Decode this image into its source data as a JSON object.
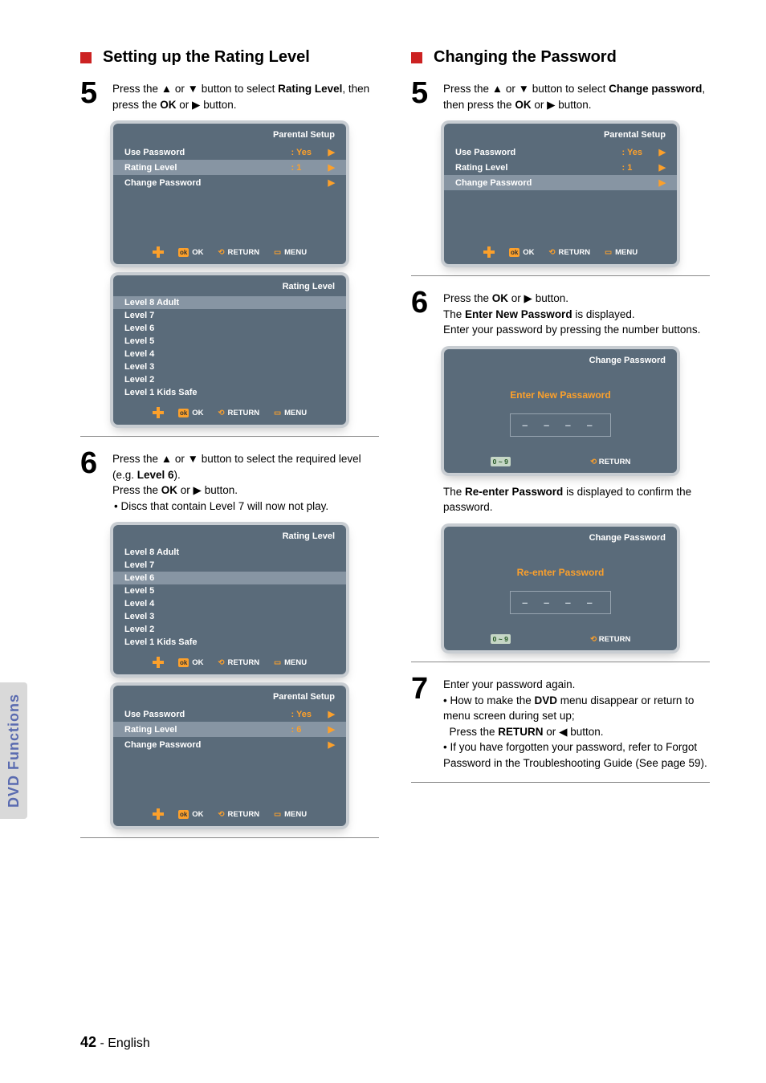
{
  "sideTab": "DVD Functions",
  "left": {
    "sectionTitle": "Setting up the Rating  Level",
    "step5": {
      "num": "5",
      "pre": "Press the ",
      "glyph1": "▲",
      "mid1": " or ",
      "glyph2": "▼",
      "mid2": " button to select ",
      "bold1": "Rating Level",
      "mid3": ", then press the ",
      "bold2": "OK",
      "mid4": " or ",
      "glyph3": "▶",
      "end": " button."
    },
    "panel1": {
      "title": "Parental Setup",
      "rows": [
        {
          "label": "Use Password",
          "value": ": Yes",
          "arrow": "▶"
        },
        {
          "label": "Rating Level",
          "value": ": 1",
          "arrow": "▶",
          "hl": true
        },
        {
          "label": "Change Password",
          "value": "",
          "arrow": "▶"
        }
      ]
    },
    "panel2": {
      "title": "Rating Level",
      "items": [
        "Level 8 Adult",
        "Level 7",
        "Level 6",
        "Level 5",
        "Level 4",
        "Level 3",
        "Level 2",
        "Level 1 Kids Safe"
      ],
      "hlIndex": 0
    },
    "step6": {
      "num": "6",
      "pre": "Press the ",
      "glyph1": "▲",
      "mid1": " or ",
      "glyph2": "▼",
      "mid2": " button to select the required level (e.g. ",
      "bold1": "Level 6",
      "mid3": ").",
      "line2a": "Press the ",
      "line2b": "OK",
      "line2c": " or ",
      "line2g": "▶",
      "line2d": " button.",
      "bullet": "• Discs that contain Level 7 will now not play."
    },
    "panel3": {
      "title": "Rating Level",
      "items": [
        "Level 8 Adult",
        "Level 7",
        "Level 6",
        "Level 5",
        "Level 4",
        "Level 3",
        "Level 2",
        "Level 1 Kids Safe"
      ],
      "hlIndex": 2
    },
    "panel4": {
      "title": "Parental Setup",
      "rows": [
        {
          "label": "Use Password",
          "value": ": Yes",
          "arrow": "▶"
        },
        {
          "label": "Rating Level",
          "value": ": 6",
          "arrow": "▶",
          "hl": true
        },
        {
          "label": "Change Password",
          "value": "",
          "arrow": "▶"
        }
      ]
    }
  },
  "right": {
    "sectionTitle": "Changing the Password",
    "step5": {
      "num": "5",
      "pre": "Press the ",
      "glyph1": "▲",
      "mid1": " or ",
      "glyph2": "▼",
      "mid2": " button to select ",
      "bold1": "Change password",
      "mid3": ", then press the ",
      "bold2": "OK",
      "mid4": " or ",
      "glyph3": "▶",
      "end": " button."
    },
    "panel1": {
      "title": "Parental Setup",
      "rows": [
        {
          "label": "Use Password",
          "value": ": Yes",
          "arrow": "▶"
        },
        {
          "label": "Rating Level",
          "value": ": 1",
          "arrow": "▶"
        },
        {
          "label": "Change Password",
          "value": "",
          "arrow": "▶",
          "hl": true
        }
      ]
    },
    "step6": {
      "num": "6",
      "l1a": "Press the ",
      "l1b": "OK",
      "l1c": " or ",
      "l1g": "▶",
      "l1d": " button.",
      "l2a": "The ",
      "l2b": "Enter New Password",
      "l2c": " is displayed.",
      "l3": "Enter your password by pressing the number buttons."
    },
    "panel2": {
      "title": "Change Password",
      "centerTitle": "Enter New Passaword",
      "dashes": "–  –  –  –",
      "keyRange": "0 ~ 9",
      "return": "RETURN"
    },
    "between": {
      "a": "The ",
      "b": "Re-enter Password",
      "c": " is displayed to confirm the password."
    },
    "panel3": {
      "title": "Change Password",
      "centerTitle": "Re-enter Password",
      "dashes": "–  –  –  –",
      "keyRange": "0 ~ 9",
      "return": "RETURN"
    },
    "step7": {
      "num": "7",
      "l1": "Enter your password again.",
      "b1a": "• How to make the ",
      "b1bold": "DVD",
      "b1b": " menu disappear or return to menu screen during set up;",
      "b2a": "Press the ",
      "b2bold": "RETURN",
      "b2b": " or ",
      "b2g": "◀",
      "b2c": " button.",
      "b3": "• If you have forgotten your password, refer to Forgot Password in the Troubleshooting Guide (See page 59)."
    }
  },
  "foot": {
    "ok": "OK",
    "return": "RETURN",
    "menu": "MENU",
    "okIcon": "ok"
  },
  "footer": {
    "page": "42",
    "dash": " - ",
    "lang": "English"
  }
}
